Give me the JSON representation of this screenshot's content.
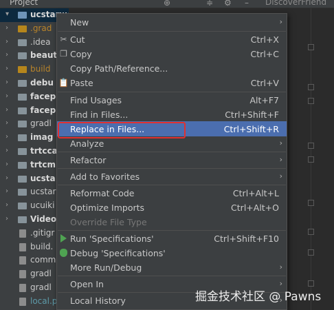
{
  "header": {
    "title": "Project",
    "tab_label": "DiscoverFriend"
  },
  "tree": [
    {
      "label": "ucstarwe",
      "style": "bold",
      "folder": "blue",
      "arrow": "▾"
    },
    {
      "label": ".grad",
      "style": "orange",
      "folder": "orange",
      "arrow": "›"
    },
    {
      "label": ".idea",
      "style": "",
      "folder": "grey",
      "arrow": "›"
    },
    {
      "label": "beaut",
      "style": "bold",
      "folder": "grey",
      "arrow": "›"
    },
    {
      "label": "build",
      "style": "orange",
      "folder": "orange",
      "arrow": "›"
    },
    {
      "label": "debu",
      "style": "bold",
      "folder": "grey",
      "arrow": "›"
    },
    {
      "label": "facep",
      "style": "bold",
      "folder": "grey",
      "arrow": "›"
    },
    {
      "label": "facep",
      "style": "bold",
      "folder": "grey",
      "arrow": "›"
    },
    {
      "label": "gradl",
      "style": "",
      "folder": "grey",
      "arrow": "›"
    },
    {
      "label": "imag",
      "style": "bold",
      "folder": "grey",
      "arrow": "›"
    },
    {
      "label": "trtcca",
      "style": "bold",
      "folder": "grey",
      "arrow": "›"
    },
    {
      "label": "trtcm",
      "style": "bold",
      "folder": "grey",
      "arrow": "›"
    },
    {
      "label": "ucsta",
      "style": "bold",
      "folder": "grey",
      "arrow": "›"
    },
    {
      "label": "ucstar",
      "style": "",
      "folder": "grey",
      "arrow": "›"
    },
    {
      "label": "ucuiki",
      "style": "",
      "folder": "grey",
      "arrow": "›"
    },
    {
      "label": "Video",
      "style": "bold",
      "folder": "grey",
      "arrow": "›"
    },
    {
      "label": ".gitigr",
      "style": "",
      "folder": "file",
      "arrow": ""
    },
    {
      "label": "build.",
      "style": "",
      "folder": "file",
      "arrow": ""
    },
    {
      "label": "comm",
      "style": "",
      "folder": "file",
      "arrow": ""
    },
    {
      "label": "gradl",
      "style": "",
      "folder": "file",
      "arrow": ""
    },
    {
      "label": "gradl",
      "style": "",
      "folder": "file",
      "arrow": ""
    },
    {
      "label": "local.p",
      "style": "teal",
      "folder": "file",
      "arrow": ""
    }
  ],
  "menu": {
    "new": "New",
    "cut": "Cut",
    "cut_sc": "Ctrl+X",
    "copy": "Copy",
    "copy_sc": "Ctrl+C",
    "copy_path": "Copy Path/Reference...",
    "paste": "Paste",
    "paste_sc": "Ctrl+V",
    "find_usages": "Find Usages",
    "find_usages_sc": "Alt+F7",
    "find_in_files": "Find in Files...",
    "find_in_files_sc": "Ctrl+Shift+F",
    "replace_in_files": "Replace in Files...",
    "replace_in_files_sc": "Ctrl+Shift+R",
    "analyze": "Analyze",
    "refactor": "Refactor",
    "add_favorites": "Add to Favorites",
    "reformat": "Reformat Code",
    "reformat_sc": "Ctrl+Alt+L",
    "optimize": "Optimize Imports",
    "optimize_sc": "Ctrl+Alt+O",
    "override": "Override File Type",
    "run": "Run 'Specifications'",
    "run_sc": "Ctrl+Shift+F10",
    "debug": "Debug 'Specifications'",
    "more_run": "More Run/Debug",
    "open_in": "Open In",
    "local_history": "Local History"
  },
  "watermark": "掘金技术社区 @ Pawns",
  "colors": {
    "menu_bg": "#3c3f41",
    "highlight": "#4b6eaf",
    "callout_border": "#e03030",
    "run_green": "#4fa352"
  }
}
